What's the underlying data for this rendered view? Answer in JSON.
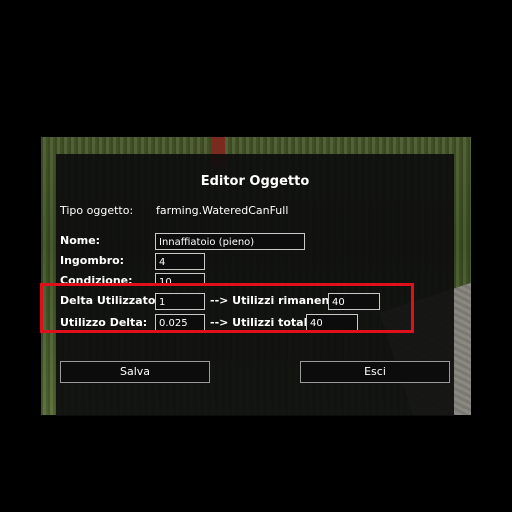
{
  "dialog": {
    "title": "Editor Oggetto",
    "item_type_label": "Tipo oggetto:",
    "item_type_value": "farming.WateredCanFull",
    "name_label": "Nome:",
    "name_value": "Innaffiatoio (pieno)",
    "weight_label": "Ingombro:",
    "weight_value": "4",
    "condition_label": "Condizione:",
    "condition_value": "10",
    "delta_used_label": "Delta Utilizzato:",
    "delta_used_value": "1",
    "uses_left_label": "--> Utilizzi rimanenti:",
    "uses_left_value": "40",
    "use_delta_label": "Utilizzo Delta:",
    "use_delta_value": "0.025",
    "total_uses_label": "--> Utilizzi totali:",
    "total_uses_value": "40",
    "save_label": "Salva",
    "exit_label": "Esci"
  },
  "colors": {
    "highlight": "#e0101a",
    "panel_bg": "#0e0e0e"
  }
}
